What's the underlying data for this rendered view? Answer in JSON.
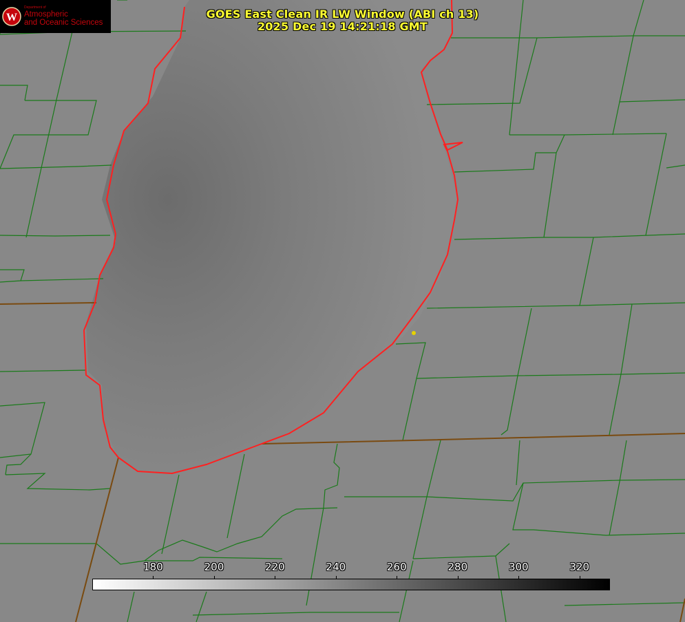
{
  "title": {
    "line1": "GOES East Clean IR LW Window (ABI ch 13)",
    "line2": "2025 Dec 19 14:21:18 GMT"
  },
  "logo": {
    "department": "Department of",
    "line1": "Atmospheric",
    "line2": "and Oceanic Sciences",
    "seal_letter": "W"
  },
  "colorbar": {
    "min": 160,
    "max": 330,
    "ticks": [
      "180",
      "200",
      "220",
      "240",
      "260",
      "280",
      "300",
      "320"
    ],
    "low_color": "#ffffff",
    "high_color": "#000000"
  },
  "map_colors": {
    "county_border": "#1a7a1a",
    "state_border": "#7a4a10",
    "lake_outline": "#ff2020",
    "land": "#878787",
    "lake_cold": "#6a6a6a",
    "marker": "#e6d200"
  }
}
